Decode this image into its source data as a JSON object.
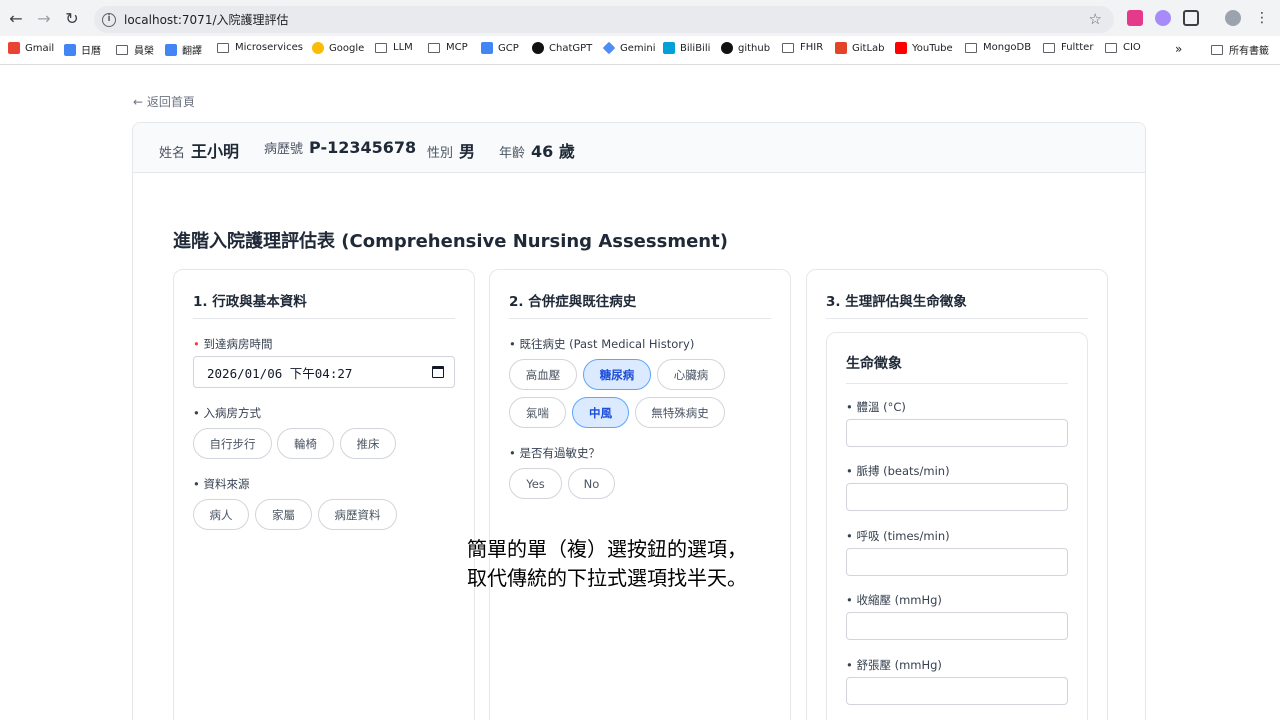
{
  "browser": {
    "url": "localhost:7071/入院護理評估",
    "bookmarks": [
      "Gmail",
      "日曆",
      "員榮",
      "翻譯",
      "Microservices",
      "Google",
      "LLM",
      "MCP",
      "GCP",
      "ChatGPT",
      "Gemini",
      "BiliBili",
      "github",
      "FHIR",
      "GitLab",
      "YouTube",
      "MongoDB",
      "Fultter",
      "CIO",
      "所有書籤"
    ],
    "overflow": "»"
  },
  "page": {
    "back_link": "← 返回首頁",
    "patient": {
      "name_label": "姓名",
      "name": "王小明",
      "mrn_label": "病歷號",
      "mrn": "P-12345678",
      "gender_label": "性別",
      "gender": "男",
      "age_label": "年齡",
      "age": "46 歲"
    },
    "form_title": "進階入院護理評估表 (Comprehensive Nursing Assessment)"
  },
  "section1": {
    "title": "1. 行政與基本資料",
    "arrival_label": "到達病房時間",
    "arrival_required": "•",
    "arrival_value": "2026/01/06  下午04:27",
    "admit_method_label": "• 入病房方式",
    "admit_methods": [
      "自行步行",
      "輪椅",
      "推床"
    ],
    "source_label": "• 資料來源",
    "sources": [
      "病人",
      "家屬",
      "病歷資料"
    ]
  },
  "section2": {
    "title": "2. 合併症與既往病史",
    "history_label": "• 既往病史 (Past Medical History)",
    "history_options": [
      "高血壓",
      "糖尿病",
      "心臟病",
      "氣喘",
      "中風",
      "無特殊病史"
    ],
    "history_selected": [
      "糖尿病",
      "中風"
    ],
    "allergy_label": "• 是否有過敏史？",
    "allergy_options": [
      "Yes",
      "No"
    ]
  },
  "section3": {
    "title": "3. 生理評估與生命徵象",
    "vitals_title": "生命徵象",
    "vitals": [
      "• 體溫 (°C)",
      "• 脈搏 (beats/min)",
      "• 呼吸 (times/min)",
      "• 收縮壓 (mmHg)",
      "• 舒張壓 (mmHg)"
    ]
  },
  "subtitle": {
    "line1": "簡單的單（複）選按鈕的選項，",
    "line2": "取代傳統的下拉式選項找半天。"
  },
  "colors": {
    "accent": "#1d4ed8",
    "selected_bg": "#dbeafe",
    "required": "#ef4444"
  }
}
